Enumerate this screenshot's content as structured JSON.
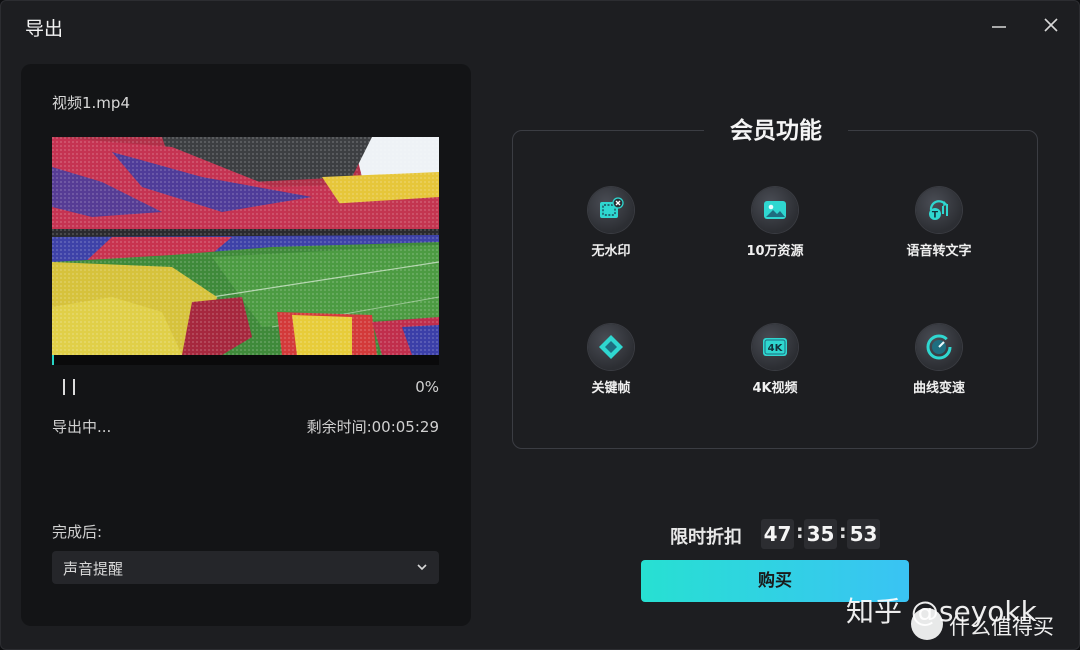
{
  "window": {
    "title": "导出"
  },
  "export": {
    "file_name": "视频1.mp4",
    "progress_percent": 0,
    "progress_text": "0%",
    "status": "导出中...",
    "remaining_label": "剩余时间:",
    "remaining_time": "00:05:29",
    "after_label": "完成后:",
    "after_value": "声音提醒"
  },
  "member": {
    "title": "会员功能",
    "features": [
      {
        "label": "无水印",
        "icon": "no-watermark-icon"
      },
      {
        "label": "10万资源",
        "icon": "image-resources-icon"
      },
      {
        "label": "语音转文字",
        "icon": "speech-to-text-icon"
      },
      {
        "label": "关键帧",
        "icon": "keyframe-icon"
      },
      {
        "label": "4K视频",
        "icon": "4k-video-icon"
      },
      {
        "label": "曲线变速",
        "icon": "curve-speed-icon"
      }
    ]
  },
  "promo": {
    "label": "限时折扣",
    "hours": "47",
    "minutes": "35",
    "seconds": "53",
    "buy_label": "购买"
  },
  "watermark": {
    "line1": "知乎 @seyokk",
    "line2": "什么值得买"
  },
  "colors": {
    "accent": "#28d4c4",
    "buy_gradient_start": "#27e0d2",
    "buy_gradient_end": "#3ac3f4"
  }
}
